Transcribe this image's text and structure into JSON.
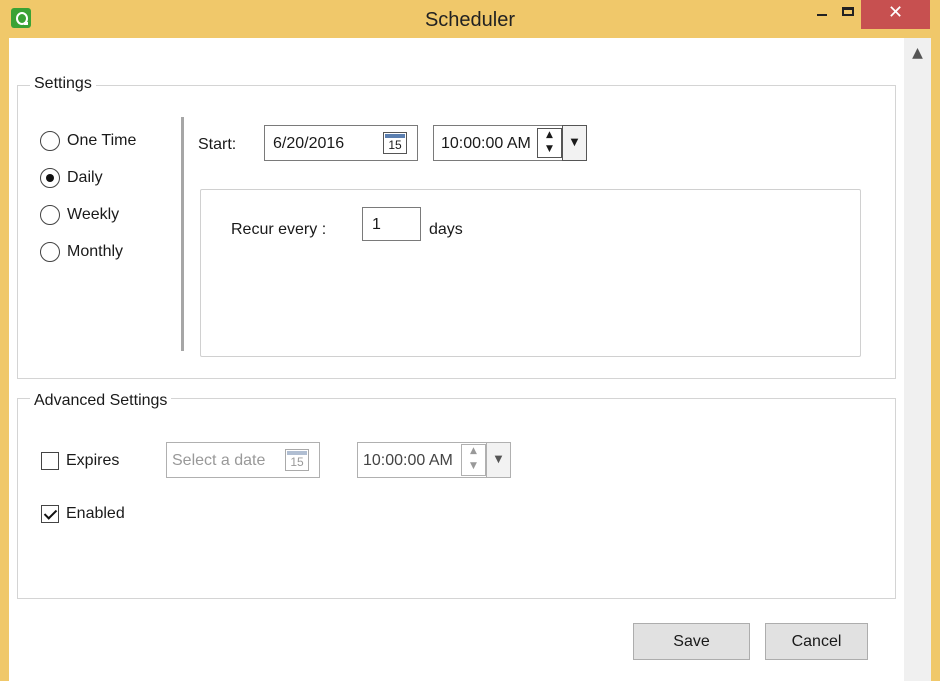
{
  "window": {
    "title": "Scheduler",
    "close_glyph": "✕"
  },
  "scrollbar": {
    "up_glyph": "▲"
  },
  "settings": {
    "legend": "Settings",
    "options": [
      {
        "label": "One Time",
        "selected": false
      },
      {
        "label": "Daily",
        "selected": true
      },
      {
        "label": "Weekly",
        "selected": false
      },
      {
        "label": "Monthly",
        "selected": false
      }
    ],
    "start_label": "Start:",
    "start_date": "6/20/2016",
    "calendar_day": "15",
    "start_time": "10:00:00 AM",
    "recur_label": "Recur every :",
    "recur_value": "1",
    "recur_unit": "days"
  },
  "advanced": {
    "legend": "Advanced Settings",
    "expires_label": "Expires",
    "expires_checked": false,
    "expires_date_placeholder": "Select a date",
    "calendar_day": "15",
    "expires_time": "10:00:00 AM",
    "enabled_label": "Enabled",
    "enabled_checked": true
  },
  "spin_up": "▲",
  "spin_down": "▼",
  "dropdown_glyph": "▼",
  "buttons": {
    "save": "Save",
    "cancel": "Cancel"
  }
}
